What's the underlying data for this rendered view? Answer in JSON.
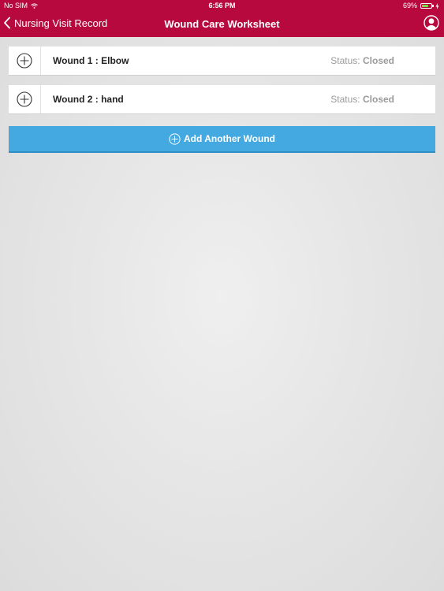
{
  "status_bar": {
    "carrier": "No SIM",
    "time": "6:56 PM",
    "battery_percent": "69%",
    "battery_level": 0.69
  },
  "nav": {
    "back_label": "Nursing Visit Record",
    "title": "Wound Care Worksheet"
  },
  "wounds": [
    {
      "name": "Wound 1 : Elbow",
      "status_label": "Status:",
      "status_value": "Closed"
    },
    {
      "name": "Wound 2 : hand",
      "status_label": "Status:",
      "status_value": "Closed"
    }
  ],
  "add_button": {
    "label": "Add Another Wound"
  },
  "colors": {
    "header": "#b8093e",
    "accent": "#43a9e0",
    "battery": "#7dde4b"
  },
  "icons": {
    "wifi": "wifi-icon",
    "battery": "battery-icon",
    "charging": "charging-bolt-icon",
    "back": "chevron-left-icon",
    "profile": "user-profile-icon",
    "expand": "plus-circle-icon",
    "add": "plus-circle-icon"
  }
}
